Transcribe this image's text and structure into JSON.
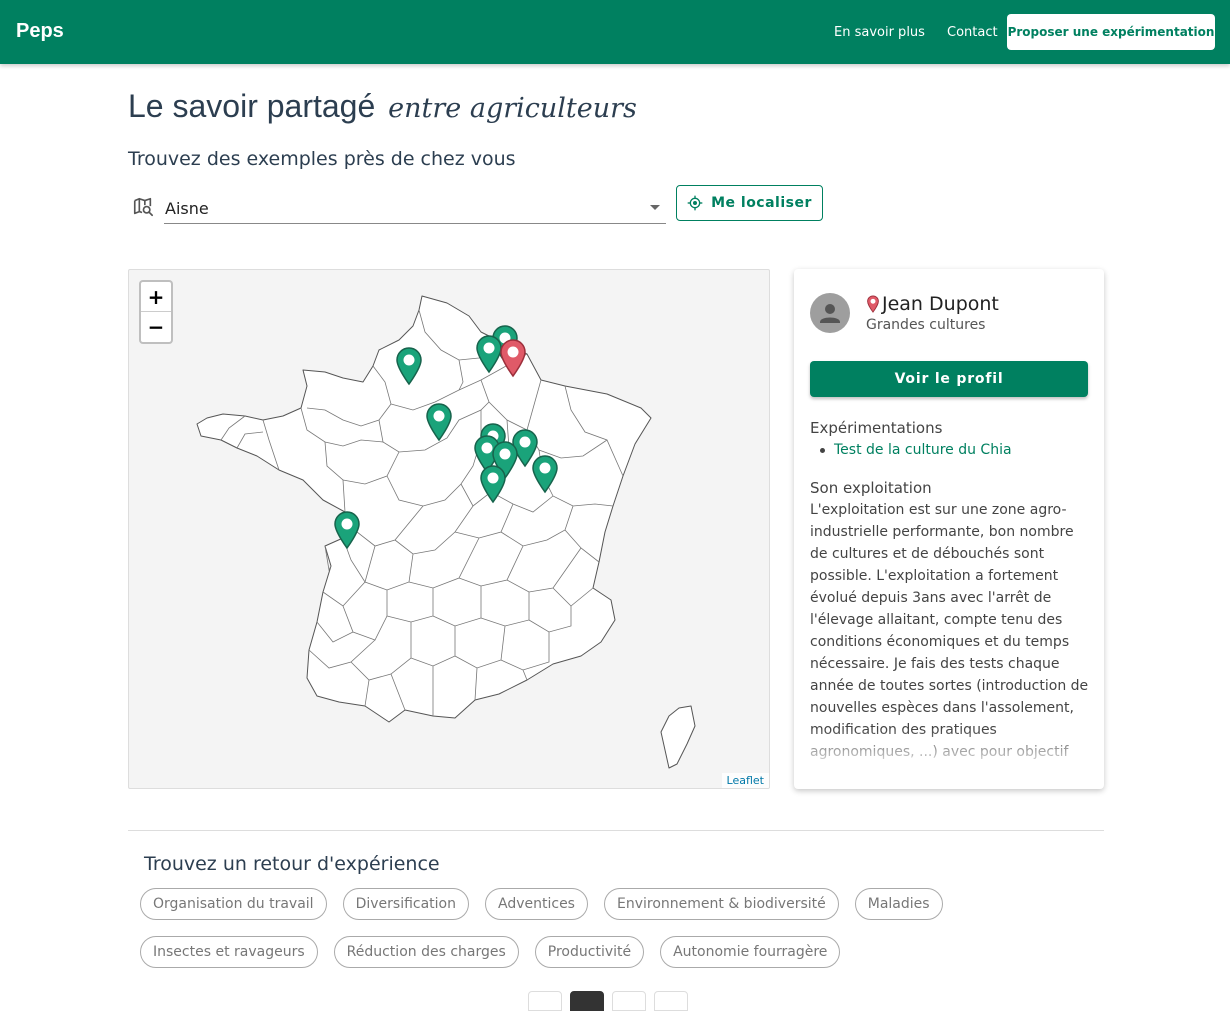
{
  "header": {
    "brand": "Peps",
    "nav": [
      "En savoir plus",
      "Contact"
    ],
    "cta": "Proposer une expérimentation",
    "color": "#008060"
  },
  "hero": {
    "title": "Le savoir partagé",
    "title_script": "entre agriculteurs",
    "subtitle": "Trouvez des exemples près de chez vous"
  },
  "search": {
    "selected": "Aisne",
    "locate_label": "Me localiser"
  },
  "map": {
    "zoom_in": "+",
    "zoom_out": "−",
    "attribution": "Leaflet",
    "marker_colors": {
      "default": "#1aa37a",
      "selected": "#e05a68"
    }
  },
  "profile": {
    "name": "Jean Dupont",
    "role": "Grandes cultures",
    "button": "Voir le profil",
    "experiments_title": "Expérimentations",
    "experiments": [
      "Test de la culture du Chia"
    ],
    "farm_title": "Son exploitation",
    "farm_description": "L'exploitation est sur une zone agro-industrielle performante, bon nombre de cultures et de débouchés sont possible. L'exploitation a fortement évolué depuis 3ans avec l'arrêt de l'élevage allaitant, compte tenu des conditions économiques et du temps nécessaire. Je fais des tests chaque année de toutes sortes (introduction de nouvelles espèces dans l'assolement, modification des pratiques agronomiques, ...) avec pour objectif d'avoir une entreprise plus résiliante en diversifiant"
  },
  "feedback": {
    "title": "Trouvez un retour d'expérience",
    "themes": [
      "Organisation du travail",
      "Diversification",
      "Adventices",
      "Environnement & biodiversité",
      "Maladies",
      "Insectes et ravageurs",
      "Réduction des charges",
      "Productivité",
      "Autonomie fourragère"
    ]
  }
}
